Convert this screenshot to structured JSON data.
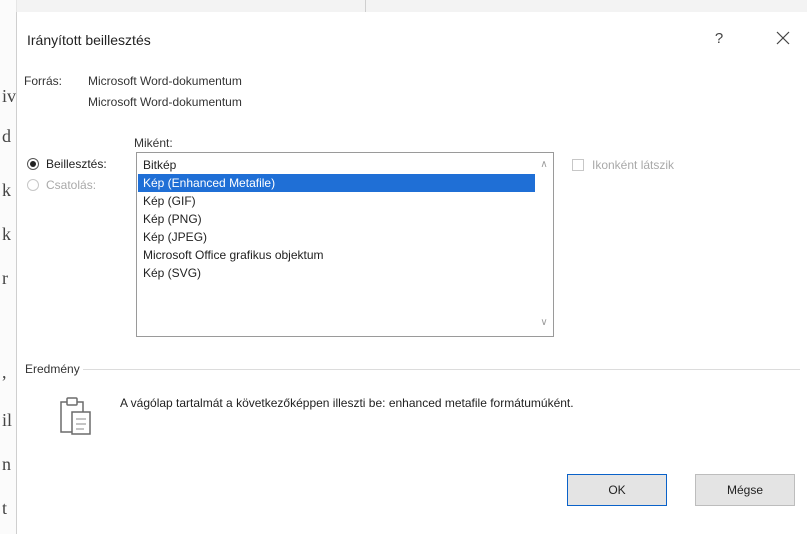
{
  "background_doc": {
    "glyphs": [
      "iv",
      "d",
      "k",
      "k",
      "r",
      ",",
      "il",
      "n",
      "t"
    ]
  },
  "dialog": {
    "title": "Irányított beillesztés",
    "help_label": "?",
    "close_icon": "close-icon",
    "source": {
      "label": "Forrás:",
      "line1": "Microsoft Word-dokumentum",
      "line2": "Microsoft Word-dokumentum"
    },
    "as_label": "Miként:",
    "options": {
      "paste_label": "Beillesztés:",
      "paste_selected": true,
      "link_label": "Csatolás:",
      "link_enabled": false
    },
    "formats": [
      "Bitkép",
      "Kép (Enhanced Metafile)",
      "Kép (GIF)",
      "Kép (PNG)",
      "Kép (JPEG)",
      "Microsoft Office grafikus objektum",
      "Kép (SVG)"
    ],
    "selected_format": "Kép (Enhanced Metafile)",
    "display_as_icon": {
      "label": "Ikonként látszik",
      "checked": false,
      "enabled": false
    },
    "result": {
      "legend": "Eredmény",
      "icon": "clipboard-paste-icon",
      "text": "A vágólap tartalmát a következőképpen illeszti be: enhanced metafile formátumúként."
    },
    "buttons": {
      "ok": "OK",
      "cancel": "Mégse"
    },
    "colors": {
      "selection": "#1f6fd6",
      "ok_border": "#0a62c9",
      "button_bg": "#e4e4e4"
    }
  }
}
